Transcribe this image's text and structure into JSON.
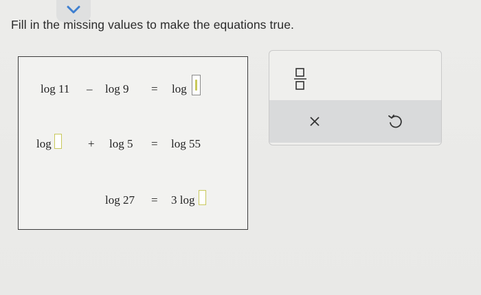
{
  "instruction": "Fill in the missing values to make the equations true.",
  "equations": {
    "row1": {
      "a": "log 11",
      "op": "–",
      "b": "log 9",
      "eq": "=",
      "c_prefix": "log"
    },
    "row2": {
      "a_prefix": "log",
      "op": "+",
      "b": "log 5",
      "eq": "=",
      "c": "log 55"
    },
    "row3": {
      "a": "log 27",
      "eq": "=",
      "c_prefix": "3 log"
    }
  },
  "toolbar": {
    "icons": [
      "fraction-template-icon",
      "clear-icon",
      "undo-icon"
    ]
  },
  "colors": {
    "input_border": "#c8c85a",
    "panel_border": "#3b3b3b",
    "toolbar_bar": "#d9dadb"
  }
}
